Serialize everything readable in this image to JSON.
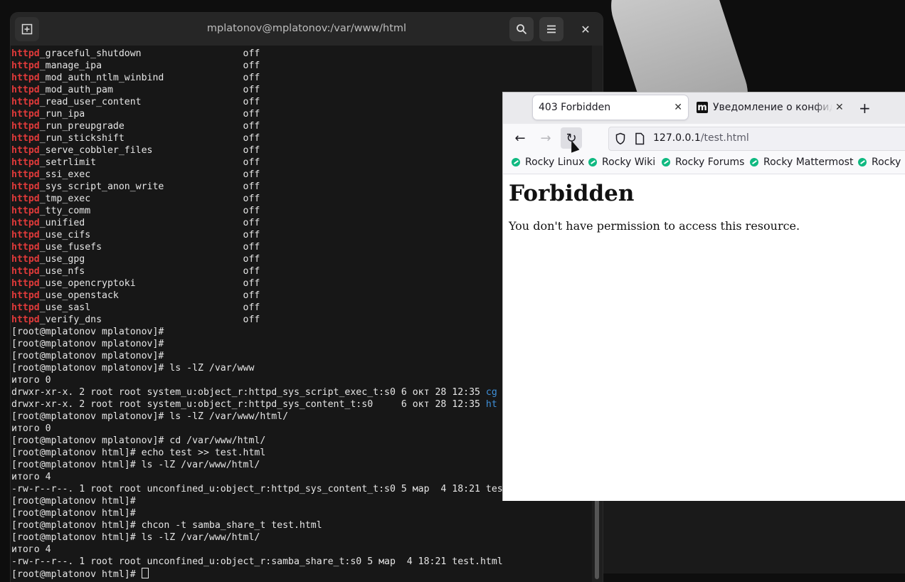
{
  "terminal": {
    "title": "mplatonov@mplatonov:/var/www/html",
    "lines": [
      {
        "kw": "httpd",
        "text": "_graceful_shutdown                  off"
      },
      {
        "kw": "httpd",
        "text": "_manage_ipa                         off"
      },
      {
        "kw": "httpd",
        "text": "_mod_auth_ntlm_winbind              off"
      },
      {
        "kw": "httpd",
        "text": "_mod_auth_pam                       off"
      },
      {
        "kw": "httpd",
        "text": "_read_user_content                  off"
      },
      {
        "kw": "httpd",
        "text": "_run_ipa                            off"
      },
      {
        "kw": "httpd",
        "text": "_run_preupgrade                     off"
      },
      {
        "kw": "httpd",
        "text": "_run_stickshift                     off"
      },
      {
        "kw": "httpd",
        "text": "_serve_cobbler_files                off"
      },
      {
        "kw": "httpd",
        "text": "_setrlimit                          off"
      },
      {
        "kw": "httpd",
        "text": "_ssi_exec                           off"
      },
      {
        "kw": "httpd",
        "text": "_sys_script_anon_write              off"
      },
      {
        "kw": "httpd",
        "text": "_tmp_exec                           off"
      },
      {
        "kw": "httpd",
        "text": "_tty_comm                           off"
      },
      {
        "kw": "httpd",
        "text": "_unified                            off"
      },
      {
        "kw": "httpd",
        "text": "_use_cifs                           off"
      },
      {
        "kw": "httpd",
        "text": "_use_fusefs                         off"
      },
      {
        "kw": "httpd",
        "text": "_use_gpg                            off"
      },
      {
        "kw": "httpd",
        "text": "_use_nfs                            off"
      },
      {
        "kw": "httpd",
        "text": "_use_opencryptoki                   off"
      },
      {
        "kw": "httpd",
        "text": "_use_openstack                      off"
      },
      {
        "kw": "httpd",
        "text": "_use_sasl                           off"
      },
      {
        "kw": "httpd",
        "text": "_verify_dns                         off"
      },
      {
        "text": "[root@mplatonov mplatonov]#"
      },
      {
        "text": "[root@mplatonov mplatonov]#"
      },
      {
        "text": "[root@mplatonov mplatonov]#"
      },
      {
        "text": "[root@mplatonov mplatonov]# ls -lZ /var/www"
      },
      {
        "text": "итого 0"
      },
      {
        "text": "drwxr-xr-x. 2 root root system_u:object_r:httpd_sys_script_exec_t:s0 6 окт 28 12:35 ",
        "tail": "cg"
      },
      {
        "text": "drwxr-xr-x. 2 root root system_u:object_r:httpd_sys_content_t:s0     6 окт 28 12:35 ",
        "tail": "ht"
      },
      {
        "text": "[root@mplatonov mplatonov]# ls -lZ /var/www/html/"
      },
      {
        "text": "итого 0"
      },
      {
        "text": "[root@mplatonov mplatonov]# cd /var/www/html/"
      },
      {
        "text": "[root@mplatonov html]# echo test >> test.html"
      },
      {
        "text": "[root@mplatonov html]# ls -lZ /var/www/html/"
      },
      {
        "text": "итого 4"
      },
      {
        "text": "-rw-r--r--. 1 root root unconfined_u:object_r:httpd_sys_content_t:s0 5 мар  4 18:21 tes"
      },
      {
        "text": "[root@mplatonov html]#"
      },
      {
        "text": "[root@mplatonov html]#"
      },
      {
        "text": "[root@mplatonov html]# chcon -t samba_share_t test.html"
      },
      {
        "text": "[root@mplatonov html]# ls -lZ /var/www/html/"
      },
      {
        "text": "итого 4"
      },
      {
        "text": "-rw-r--r--. 1 root root unconfined_u:object_r:samba_share_t:s0 5 мар  4 18:21 test.html"
      },
      {
        "text": "[root@mplatonov html]# ",
        "cursor": true
      }
    ]
  },
  "browser": {
    "tabs": [
      {
        "label": "403 Forbidden"
      },
      {
        "label": "Уведомление о конфиде"
      }
    ],
    "url_host": "127.0.0.1",
    "url_path": "/test.html",
    "bookmarks": [
      "Rocky Linux",
      "Rocky Wiki",
      "Rocky Forums",
      "Rocky Mattermost",
      "Rocky R"
    ],
    "page_heading": "Forbidden",
    "page_text": "You don't have permission to access this resource."
  },
  "icons": {
    "newtab_favicon_letter": "m"
  }
}
